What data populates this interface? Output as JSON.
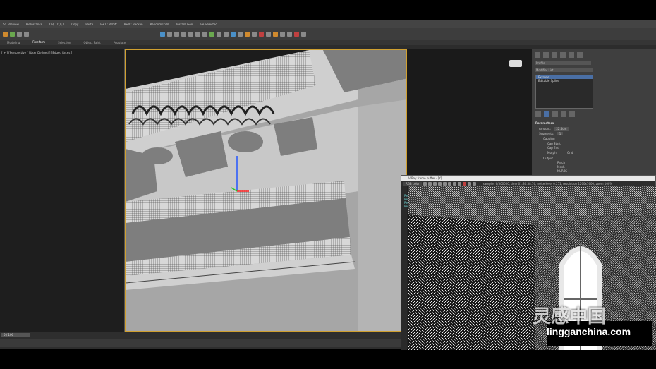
{
  "menubar": {
    "items": [
      "Sc. Preview",
      "P3 Instance",
      "OBJ : 0,0,0",
      "Copy",
      "Paste",
      "P+1 : Rshift",
      "P+4 : Backen",
      "Random UVW",
      "Instant Geo",
      "ale Selected"
    ]
  },
  "ribbon": {
    "tabs": [
      "Modeling",
      "Freeform",
      "Selection",
      "Object Paint",
      "Populate"
    ],
    "active": "Freeform"
  },
  "viewport_left": {
    "label": "[ + ] [Perspective ] [User Defined ] [Edged Faces ]"
  },
  "command_panel": {
    "object_name": "Profile",
    "modifier_list": "Modifier List",
    "stack": [
      "Extrude",
      "Editable Spline"
    ],
    "params_title": "Parameters",
    "amount_label": "Amount:",
    "amount_value": "22.5cm",
    "segments_label": "Segments:",
    "segments_value": "1",
    "capping_label": "Capping",
    "cap_start": "Cap Start",
    "cap_end": "Cap End",
    "morph": "Morph",
    "grid": "Grid",
    "output_label": "Output",
    "patch": "Patch",
    "mesh": "Mesh",
    "nurbs": "NURBS"
  },
  "vfb": {
    "title": "V-Ray frame buffer - [Y]",
    "channel": "RGB color",
    "status": "samples 6/300000, time 01:30:38.76, noise level 0.251, resolution 1200x1600, zoom 100%",
    "history": [
      "Restoring from 4%",
      "Restoring from 2%",
      "Restoring from 2%",
      "Restoring from 4%"
    ]
  },
  "timeline": {
    "counter": "0 / 100"
  },
  "watermark": {
    "cn": "灵感中国",
    "en": "lingganchina.com"
  }
}
